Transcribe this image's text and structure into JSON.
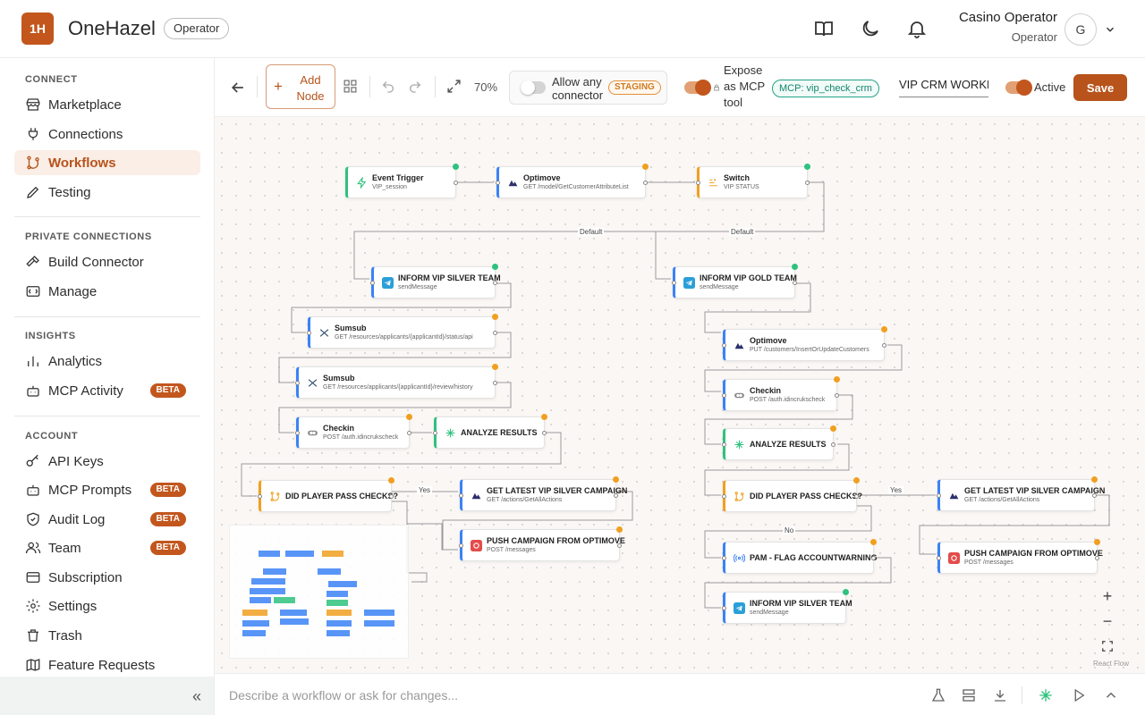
{
  "header": {
    "logo_text": "1H",
    "app_name": "OneHazel",
    "role_badge": "Operator",
    "user_name": "Casino Operator",
    "user_role": "Operator",
    "avatar_initial": "G"
  },
  "sidebar": {
    "sections": [
      {
        "title": "CONNECT",
        "items": [
          {
            "label": "Marketplace",
            "icon": "store-icon"
          },
          {
            "label": "Connections",
            "icon": "plug-icon"
          },
          {
            "label": "Workflows",
            "icon": "git-branch-icon",
            "active": true
          },
          {
            "label": "Testing",
            "icon": "pencil-icon"
          }
        ]
      },
      {
        "title": "PRIVATE CONNECTIONS",
        "items": [
          {
            "label": "Build Connector",
            "icon": "hammer-icon"
          },
          {
            "label": "Manage",
            "icon": "manage-icon"
          }
        ]
      },
      {
        "title": "INSIGHTS",
        "items": [
          {
            "label": "Analytics",
            "icon": "bar-chart-icon"
          },
          {
            "label": "MCP Activity",
            "icon": "bot-icon",
            "badge": "BETA"
          }
        ]
      },
      {
        "title": "ACCOUNT",
        "items": [
          {
            "label": "API Keys",
            "icon": "key-icon"
          },
          {
            "label": "MCP Prompts",
            "icon": "bot-icon",
            "badge": "BETA"
          },
          {
            "label": "Audit Log",
            "icon": "shield-icon",
            "badge": "BETA"
          },
          {
            "label": "Team",
            "icon": "users-icon",
            "badge": "BETA"
          },
          {
            "label": "Subscription",
            "icon": "credit-card-icon"
          },
          {
            "label": "Settings",
            "icon": "gear-icon"
          },
          {
            "label": "Trash",
            "icon": "trash-icon"
          },
          {
            "label": "Feature Requests",
            "icon": "map-icon"
          }
        ]
      }
    ],
    "collapse_glyph": "«"
  },
  "toolbar": {
    "add_node_label": "Add Node",
    "zoom_level": "70%",
    "allow_connector_label": "Allow any connector",
    "staging_badge": "STAGING",
    "expose_label": "Expose as MCP tool",
    "mcp_pill": "MCP: vip_check_crm",
    "workflow_name": "VIP CRM WORKFLOW",
    "active_label": "Active",
    "save_label": "Save"
  },
  "canvas": {
    "nodes": [
      {
        "id": "n1",
        "title": "Event Trigger",
        "sub": "VIP_session",
        "color": "green",
        "icon": "bolt-icon",
        "status": "g"
      },
      {
        "id": "n2",
        "title": "Optimove",
        "sub": "GET /model/GetCustomerAttributeList",
        "color": "blue",
        "icon": "optimove-icon",
        "status": "o"
      },
      {
        "id": "n3",
        "title": "Switch",
        "sub": "VIP STATUS",
        "color": "orange",
        "icon": "switch-icon",
        "status": "g"
      },
      {
        "id": "n4",
        "title": "INFORM VIP SILVER TEAM",
        "sub": "sendMessage",
        "color": "blue",
        "icon": "telegram-icon",
        "status": "g"
      },
      {
        "id": "n5",
        "title": "Sumsub",
        "sub": "GET /resources/applicants/{applicantId}/status/api",
        "color": "blue",
        "icon": "sumsub-icon",
        "status": "o"
      },
      {
        "id": "n6",
        "title": "Sumsub",
        "sub": "GET /resources/applicants/{applicantId}/review/history",
        "color": "blue",
        "icon": "sumsub-icon",
        "status": "o"
      },
      {
        "id": "n7",
        "title": "Checkin",
        "sub": "POST /auth.idincrukscheck",
        "color": "blue",
        "icon": "checkin-icon",
        "status": "o"
      },
      {
        "id": "n8",
        "title": "ANALYZE RESULTS",
        "sub": "",
        "color": "green",
        "icon": "ai-sparkle-icon",
        "status": "o"
      },
      {
        "id": "n9",
        "title": "DID PLAYER PASS CHECKS?",
        "sub": "",
        "color": "orange",
        "icon": "branch-icon",
        "status": "o"
      },
      {
        "id": "n10",
        "title": "GET LATEST VIP SILVER CAMPAIGN",
        "sub": "GET /actions/GetAllActions",
        "color": "blue",
        "icon": "optimove-icon",
        "status": "o"
      },
      {
        "id": "n11",
        "title": "PUSH CAMPAIGN FROM OPTIMOVE",
        "sub": "POST /messages",
        "color": "blue",
        "icon": "push-icon",
        "status": "o"
      },
      {
        "id": "n12",
        "title": "INFORM VIP GOLD TEAM",
        "sub": "sendMessage",
        "color": "blue",
        "icon": "telegram-icon",
        "status": "g"
      },
      {
        "id": "n13",
        "title": "Optimove",
        "sub": "PUT /customers/InsertOrUpdateCustomers",
        "color": "blue",
        "icon": "optimove-icon",
        "status": "o"
      },
      {
        "id": "n14",
        "title": "Checkin",
        "sub": "POST /auth.idincrukscheck",
        "color": "blue",
        "icon": "checkin-icon",
        "status": "o"
      },
      {
        "id": "n15",
        "title": "ANALYZE RESULTS",
        "sub": "",
        "color": "green",
        "icon": "ai-sparkle-icon",
        "status": "o"
      },
      {
        "id": "n16",
        "title": "DID PLAYER PASS CHECKS?",
        "sub": "",
        "color": "orange",
        "icon": "branch-icon",
        "status": "o"
      },
      {
        "id": "n17",
        "title": "GET LATEST VIP SILVER CAMPAIGN",
        "sub": "GET /actions/GetAllActions",
        "color": "blue",
        "icon": "optimove-icon",
        "status": "o"
      },
      {
        "id": "n18",
        "title": "PUSH CAMPAIGN FROM OPTIMOVE",
        "sub": "POST /messages",
        "color": "blue",
        "icon": "push-icon",
        "status": "o"
      },
      {
        "id": "n19",
        "title": "PAM - FLAG ACCOUNTWARNING",
        "sub": "",
        "color": "blue",
        "icon": "broadcast-icon",
        "status": "o"
      },
      {
        "id": "n20",
        "title": "INFORM VIP SILVER TEAM",
        "sub": "sendMessage",
        "color": "blue",
        "icon": "telegram-icon",
        "status": "g"
      }
    ],
    "edge_labels": {
      "default_1": "Default",
      "default_2": "Default",
      "yes_1": "Yes",
      "yes_2": "Yes",
      "no_1": "No"
    },
    "attribution": "React Flow"
  },
  "prompt": {
    "placeholder": "Describe a workflow or ask for changes..."
  },
  "colors": {
    "brand": "#c2561d",
    "active_nav_bg": "#faeee6",
    "node_blue": "#3b82f6",
    "node_orange": "#f0a020",
    "node_green": "#2ec27e"
  }
}
